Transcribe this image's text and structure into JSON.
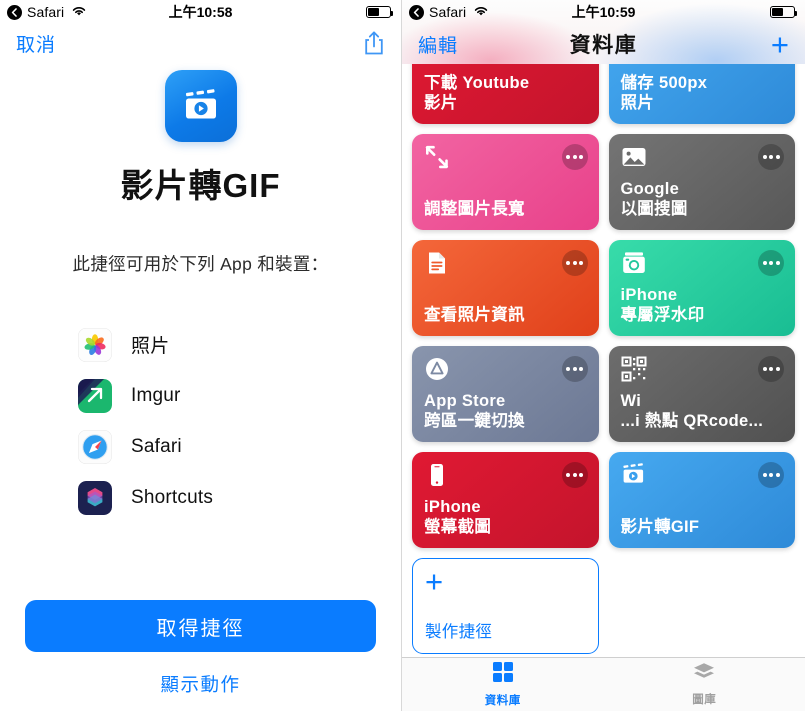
{
  "left": {
    "status": {
      "back_label": "Safari",
      "wifi_icon": "wifi-icon",
      "time": "上午10:58",
      "battery_icon": "battery-icon",
      "battery_level": 50
    },
    "nav": {
      "cancel_label": "取消",
      "share_icon": "share-icon"
    },
    "shortcut": {
      "icon": "video-clapper-icon",
      "title": "影片轉GIF",
      "description": "此捷徑可用於下列 App 和裝置："
    },
    "apps": [
      {
        "name": "照片",
        "icon": "photos-app-icon"
      },
      {
        "name": "Imgur",
        "icon": "imgur-app-icon"
      },
      {
        "name": "Safari",
        "icon": "safari-app-icon"
      },
      {
        "name": "Shortcuts",
        "icon": "shortcuts-app-icon"
      }
    ],
    "footer": {
      "get_label": "取得捷徑",
      "show_actions_label": "顯示動作"
    }
  },
  "right": {
    "status": {
      "back_label": "Safari",
      "wifi_icon": "wifi-icon",
      "time": "上午10:59",
      "battery_icon": "battery-icon",
      "battery_level": 50
    },
    "nav": {
      "edit_label": "編輯",
      "title": "資料庫",
      "add_icon": "plus-icon",
      "add_label": "+"
    },
    "tiles": [
      {
        "name": "下載 Youtube\n影片",
        "color": "#e01933",
        "color2": "#c4142c",
        "icon": "none",
        "menu": "more-icon",
        "clipped": true
      },
      {
        "name": "儲存 500px\n照片",
        "color": "#3aa0ee",
        "color2": "#2e8ad8",
        "icon": "none",
        "menu": "more-icon",
        "clipped": true
      },
      {
        "name": "調整圖片長寬",
        "color": "#ef4d94",
        "color2": "#e8418a",
        "icon": "resize-icon",
        "menu": "more-icon",
        "clipped": false
      },
      {
        "name": "Google\n以圖搜圖",
        "color": "#6b6b6b",
        "color2": "#5a5a5a",
        "icon": "picture-icon",
        "menu": "more-icon",
        "clipped": false
      },
      {
        "name": "查看照片資訊",
        "color": "#f15a2b",
        "color2": "#e0401a",
        "icon": "document-icon",
        "menu": "more-icon",
        "clipped": false
      },
      {
        "name": "iPhone\n專屬浮水印",
        "color": "#2ecfa0",
        "color2": "#1cbd94",
        "icon": "camera-icon",
        "menu": "more-icon",
        "clipped": false
      },
      {
        "name": "App Store\n跨區一鍵切換",
        "color": "#7d8aa3",
        "color2": "#6c7894",
        "icon": "appstore-icon",
        "menu": "more-icon",
        "clipped": false
      },
      {
        "name": "Wi\n...i 熱點 QRcode...",
        "color": "#636363",
        "color2": "#545454",
        "icon": "qrcode-icon",
        "menu": "more-icon",
        "clipped": false
      },
      {
        "name": "iPhone\n螢幕截圖",
        "color": "#e01933",
        "color2": "#c4142c",
        "icon": "phone-icon",
        "menu": "more-icon",
        "clipped": false
      },
      {
        "name": "影片轉GIF",
        "color": "#3aa0ee",
        "color2": "#2e8ad8",
        "icon": "video-clapper-icon",
        "menu": "more-icon",
        "clipped": false
      }
    ],
    "create_tile": {
      "label": "製作捷徑",
      "icon": "plus-icon"
    },
    "tabs": [
      {
        "label": "資料庫",
        "icon": "grid-icon",
        "active": true
      },
      {
        "label": "圖庫",
        "icon": "layers-icon",
        "active": false
      }
    ]
  }
}
